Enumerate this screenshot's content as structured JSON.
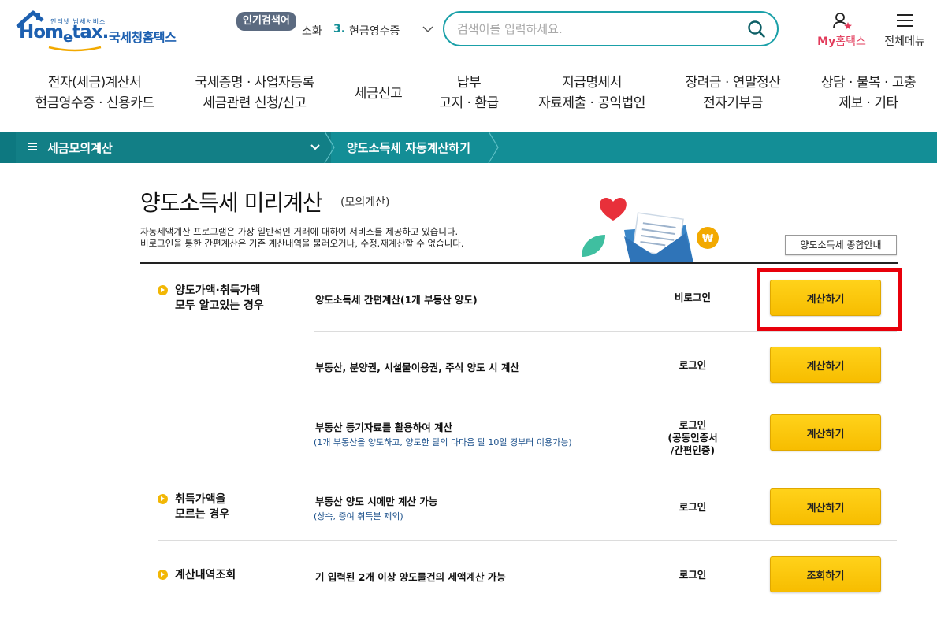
{
  "header": {
    "logo_tag": "인터넷 납세서비스",
    "logo_word_a": "Hom",
    "logo_word_e": "e",
    "logo_word_b": "tax.",
    "logo_kr": "국세청홈택스",
    "popular_label": "인기검색어",
    "ticker_prev": "소화",
    "ticker_num": "3.",
    "ticker_text": "현금영수증",
    "search_placeholder": "검색어를 입력하세요.",
    "my_hometax_a": "My",
    "my_hometax_b": "홈택스",
    "all_menu": "전체메뉴"
  },
  "gnb": [
    {
      "line1": "전자(세금)계산서",
      "line2": "현금영수증 · 신용카드"
    },
    {
      "line1": "국세증명 · 사업자등록",
      "line2": "세금관련 신청/신고"
    },
    {
      "line1": "세금신고",
      "line2": ""
    },
    {
      "line1": "납부",
      "line2": "고지 · 환급"
    },
    {
      "line1": "지급명세서",
      "line2": "자료제출 · 공익법인"
    },
    {
      "line1": "장려금 · 연말정산",
      "line2": "전자기부금"
    },
    {
      "line1": "상담 · 불복 · 고충",
      "line2": "제보 · 기타"
    }
  ],
  "breadcrumb": {
    "menu_label": "세금모의계산",
    "current": "양도소득세 자동계산하기"
  },
  "content": {
    "title": "양도소득세 미리계산",
    "subtitle": "(모의계산)",
    "desc_line1": "자동세액계산 프로그램은 가장 일반적인 거래에 대하여 서비스를 제공하고 있습니다.",
    "desc_line2": "비로그인을 통한 간편계산은 기존 계산내역을 불러오거나, 수정.재계산할 수 없습니다.",
    "guide_button": "양도소득세 종합안내"
  },
  "categories": [
    {
      "line1": "양도가액·취득가액",
      "line2": "모두 알고있는 경우"
    },
    {
      "line1": "취득가액을",
      "line2": "모르는 경우"
    },
    {
      "line1": "계산내역조회",
      "line2": ""
    }
  ],
  "rows": [
    {
      "title": "양도소득세 간편계산(1개 부동산 양도)",
      "note": "",
      "login1": "비로그인",
      "login2": "",
      "login3": "",
      "button": "계산하기"
    },
    {
      "title": "부동산, 분양권, 시설물이용권, 주식 양도 시 계산",
      "note": "",
      "login1": "로그인",
      "login2": "",
      "login3": "",
      "button": "계산하기"
    },
    {
      "title": "부동산 등기자료를 활용하여 계산",
      "note": "(1개 부동산을 양도하고, 양도한 달의 다다음 달 10일 경부터 이용가능)",
      "login1": "로그인",
      "login2": "(공동인증서",
      "login3": "/간편인증)",
      "button": "계산하기"
    },
    {
      "title": "부동산 양도 시에만 계산 가능",
      "note": "(상속, 증여 취득분 제외)",
      "login1": "로그인",
      "login2": "",
      "login3": "",
      "button": "계산하기"
    },
    {
      "title": "기 입력된 2개 이상 양도물건의 세액계산 가능",
      "note": "",
      "login1": "로그인",
      "login2": "",
      "login3": "",
      "button": "조회하기"
    }
  ],
  "colors": {
    "brand_blue": "#1d60b0",
    "teal": "#138e96",
    "button_yellow": "#f7bd00",
    "highlight_red": "#e8000b"
  }
}
